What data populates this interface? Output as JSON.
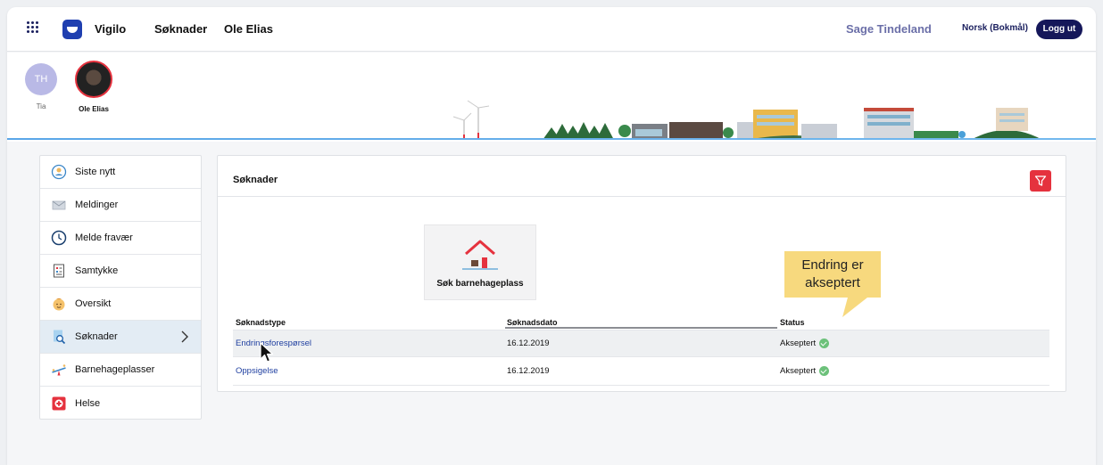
{
  "header": {
    "app_name": "Vigilo",
    "nav_applications": "Søknader",
    "nav_child": "Ole Elias",
    "user_name": "Sage Tindeland",
    "language": "Norsk (Bokmål)",
    "logout": "Logg ut"
  },
  "children": [
    {
      "initials": "TH",
      "name": "Tia"
    },
    {
      "name": "Ole Elias"
    }
  ],
  "sidebar": {
    "items": [
      {
        "label": "Siste nytt",
        "icon": "news-icon"
      },
      {
        "label": "Meldinger",
        "icon": "envelope-icon"
      },
      {
        "label": "Melde fravær",
        "icon": "clock-icon"
      },
      {
        "label": "Samtykke",
        "icon": "checklist-icon"
      },
      {
        "label": "Oversikt",
        "icon": "child-face-icon"
      },
      {
        "label": "Søknader",
        "icon": "document-search-icon"
      },
      {
        "label": "Barnehageplasser",
        "icon": "seesaw-icon"
      },
      {
        "label": "Helse",
        "icon": "health-cross-icon"
      }
    ]
  },
  "panel": {
    "title": "Søknader",
    "tile_label": "Søk barnehageplass",
    "columns": [
      "Søknadstype",
      "Søknadsdato",
      "Status"
    ],
    "rows": [
      {
        "type": "Endringsforespørsel",
        "date": "16.12.2019",
        "status": "Akseptert"
      },
      {
        "type": "Oppsigelse",
        "date": "16.12.2019",
        "status": "Akseptert"
      }
    ]
  },
  "callout": {
    "line1": "Endring er",
    "line2": "akseptert"
  },
  "colors": {
    "brand_navy": "#15175a",
    "accent_red": "#e5323e",
    "link_blue": "#1f3fa0",
    "status_green": "#6cc17a",
    "callout_yellow": "#f7d97e"
  }
}
